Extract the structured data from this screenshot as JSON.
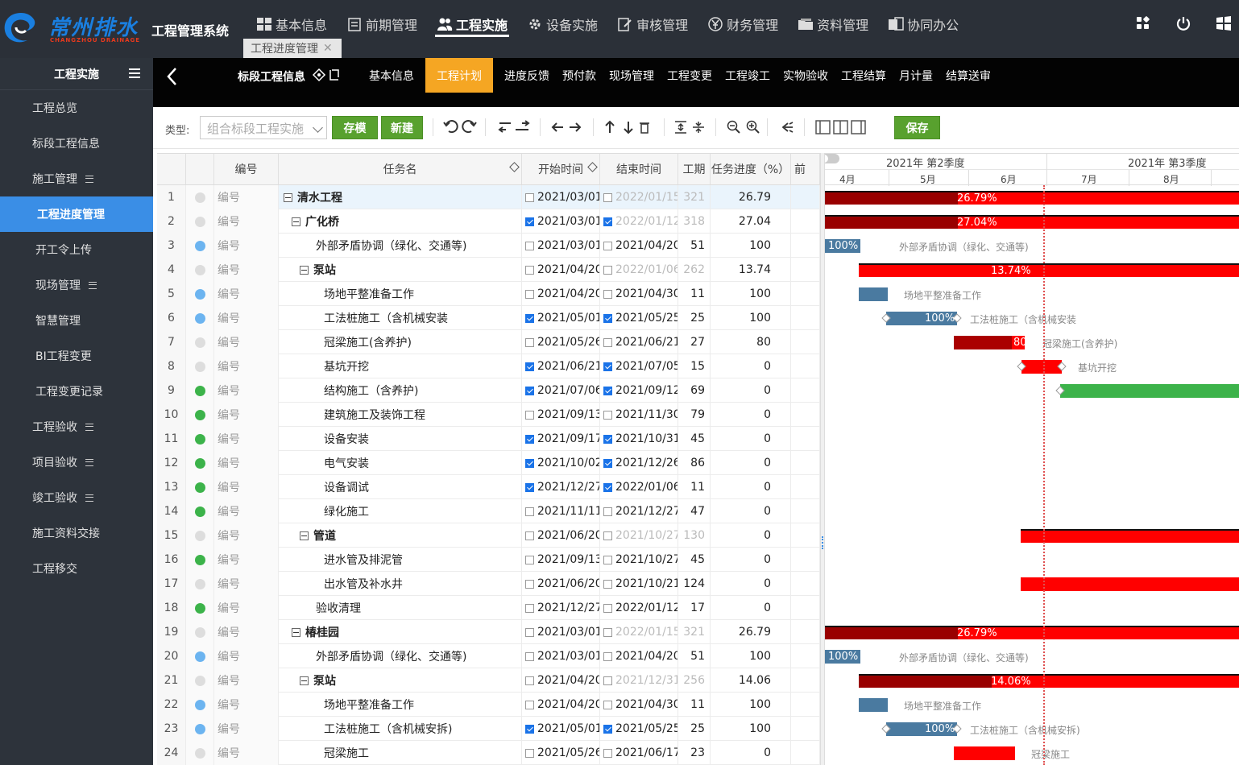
{
  "app": {
    "brand": "常州排水",
    "brand_sub": "CHANGZHOU DRAINAGE",
    "system_name": "工程管理系统"
  },
  "topnav": [
    {
      "label": "基本信息",
      "icon": "grid-icon"
    },
    {
      "label": "前期管理",
      "icon": "clipboard-icon"
    },
    {
      "label": "工程实施",
      "icon": "people-icon",
      "active": true
    },
    {
      "label": "设备实施",
      "icon": "cog-icon"
    },
    {
      "label": "审核管理",
      "icon": "edit-icon"
    },
    {
      "label": "财务管理",
      "icon": "yen-icon"
    },
    {
      "label": "资料管理",
      "icon": "folder-icon"
    },
    {
      "label": "协同办公",
      "icon": "doc-icon"
    }
  ],
  "open_tab": {
    "label": "工程进度管理"
  },
  "sidebar": {
    "title": "工程实施",
    "items": [
      {
        "label": "工程总览"
      },
      {
        "label": "标段工程信息"
      },
      {
        "label": "施工管理"
      },
      {
        "label": "工程进度管理"
      },
      {
        "label": "开工令上传"
      },
      {
        "label": "现场管理"
      },
      {
        "label": "智慧管理"
      },
      {
        "label": "BI工程变更"
      },
      {
        "label": "工程变更记录"
      },
      {
        "label": "工程验收"
      },
      {
        "label": "项目验收"
      },
      {
        "label": "竣工验收"
      },
      {
        "label": "施工资料交接"
      },
      {
        "label": "工程移交"
      }
    ]
  },
  "section": {
    "title": "标段工程信息",
    "tabs": [
      "基本信息",
      "工程计划",
      "进度反馈",
      "预付款",
      "现场管理",
      "工程变更",
      "工程竣工",
      "实物验收",
      "工程结算",
      "月计量",
      "结算送审"
    ],
    "active_tab": "工程计划"
  },
  "toolbar": {
    "type_label": "类型:",
    "type_value": "组合标段工程实施",
    "save_template": "存模",
    "new": "新建",
    "save": "保存"
  },
  "grid": {
    "headers": {
      "code": "编号",
      "name": "任务名",
      "start": "开始时间",
      "end": "结束时间",
      "duration": "工期",
      "progress": "任务进度（%）",
      "pred": "前"
    },
    "rows": [
      {
        "n": "1",
        "dot": "#dddddd",
        "code": "编号",
        "name": "清水工程",
        "level": 0,
        "bold": true,
        "toggle": true,
        "s_chk": false,
        "start": "2021/03/01",
        "e_chk": false,
        "end": "2022/01/15",
        "end_grey": true,
        "dur": "321",
        "progress": "26.79"
      },
      {
        "n": "2",
        "dot": "#dddddd",
        "code": "编号",
        "name": "广化桥",
        "level": 1,
        "bold": true,
        "toggle": true,
        "s_chk": true,
        "start": "2021/03/01",
        "e_chk": true,
        "end": "2022/01/12",
        "end_grey": true,
        "dur": "318",
        "progress": "27.04"
      },
      {
        "n": "3",
        "dot": "#6cb4f0",
        "code": "编号",
        "name": "外部矛盾协调（绿化、交通等)",
        "level": 2,
        "bold": false,
        "toggle": false,
        "s_chk": false,
        "start": "2021/03/01",
        "e_chk": false,
        "end": "2021/04/20",
        "end_grey": false,
        "dur": "51",
        "progress": "100"
      },
      {
        "n": "4",
        "dot": "#dddddd",
        "code": "编号",
        "name": "泵站",
        "level": 2,
        "bold": true,
        "toggle": true,
        "s_chk": false,
        "start": "2021/04/20",
        "e_chk": false,
        "end": "2022/01/06",
        "end_grey": true,
        "dur": "262",
        "progress": "13.74"
      },
      {
        "n": "5",
        "dot": "#6cb4f0",
        "code": "编号",
        "name": "场地平整准备工作",
        "level": 3,
        "bold": false,
        "toggle": false,
        "s_chk": false,
        "start": "2021/04/20",
        "e_chk": false,
        "end": "2021/04/30",
        "end_grey": false,
        "dur": "11",
        "progress": "100"
      },
      {
        "n": "6",
        "dot": "#6cb4f0",
        "code": "编号",
        "name": "工法桩施工（含机械安装",
        "level": 3,
        "bold": false,
        "toggle": false,
        "s_chk": true,
        "start": "2021/05/01",
        "e_chk": true,
        "end": "2021/05/25",
        "end_grey": false,
        "dur": "25",
        "progress": "100"
      },
      {
        "n": "7",
        "dot": "#dddddd",
        "code": "编号",
        "name": "冠梁施工(含养护)",
        "level": 3,
        "bold": false,
        "toggle": false,
        "s_chk": false,
        "start": "2021/05/26",
        "e_chk": false,
        "end": "2021/06/21",
        "end_grey": false,
        "dur": "27",
        "progress": "80"
      },
      {
        "n": "8",
        "dot": "#dddddd",
        "code": "编号",
        "name": "基坑开挖",
        "level": 3,
        "bold": false,
        "toggle": false,
        "s_chk": true,
        "start": "2021/06/21",
        "e_chk": true,
        "end": "2021/07/05",
        "end_grey": false,
        "dur": "15",
        "progress": "0"
      },
      {
        "n": "9",
        "dot": "#3cb34a",
        "code": "编号",
        "name": "结构施工（含养护)",
        "level": 3,
        "bold": false,
        "toggle": false,
        "s_chk": true,
        "start": "2021/07/06",
        "e_chk": true,
        "end": "2021/09/12",
        "end_grey": false,
        "dur": "69",
        "progress": "0"
      },
      {
        "n": "10",
        "dot": "#3cb34a",
        "code": "编号",
        "name": "建筑施工及装饰工程",
        "level": 3,
        "bold": false,
        "toggle": false,
        "s_chk": false,
        "start": "2021/09/13",
        "e_chk": false,
        "end": "2021/11/30",
        "end_grey": false,
        "dur": "79",
        "progress": "0"
      },
      {
        "n": "11",
        "dot": "#3cb34a",
        "code": "编号",
        "name": "设备安装",
        "level": 3,
        "bold": false,
        "toggle": false,
        "s_chk": true,
        "start": "2021/09/17",
        "e_chk": true,
        "end": "2021/10/31",
        "end_grey": false,
        "dur": "45",
        "progress": "0"
      },
      {
        "n": "12",
        "dot": "#3cb34a",
        "code": "编号",
        "name": "电气安装",
        "level": 3,
        "bold": false,
        "toggle": false,
        "s_chk": true,
        "start": "2021/10/02",
        "e_chk": true,
        "end": "2021/12/26",
        "end_grey": false,
        "dur": "86",
        "progress": "0"
      },
      {
        "n": "13",
        "dot": "#3cb34a",
        "code": "编号",
        "name": "设备调试",
        "level": 3,
        "bold": false,
        "toggle": false,
        "s_chk": true,
        "start": "2021/12/27",
        "e_chk": true,
        "end": "2022/01/06",
        "end_grey": false,
        "dur": "11",
        "progress": "0"
      },
      {
        "n": "14",
        "dot": "#3cb34a",
        "code": "编号",
        "name": "绿化施工",
        "level": 3,
        "bold": false,
        "toggle": false,
        "s_chk": false,
        "start": "2021/11/11",
        "e_chk": false,
        "end": "2021/12/27",
        "end_grey": false,
        "dur": "47",
        "progress": "0"
      },
      {
        "n": "15",
        "dot": "#dddddd",
        "code": "编号",
        "name": "管道",
        "level": 2,
        "bold": true,
        "toggle": true,
        "s_chk": false,
        "start": "2021/06/20",
        "e_chk": false,
        "end": "2021/10/27",
        "end_grey": true,
        "dur": "130",
        "progress": "0"
      },
      {
        "n": "16",
        "dot": "#3cb34a",
        "code": "编号",
        "name": "进水管及排泥管",
        "level": 3,
        "bold": false,
        "toggle": false,
        "s_chk": false,
        "start": "2021/09/13",
        "e_chk": false,
        "end": "2021/10/27",
        "end_grey": false,
        "dur": "45",
        "progress": "0"
      },
      {
        "n": "17",
        "dot": "#dddddd",
        "code": "编号",
        "name": "出水管及补水井",
        "level": 3,
        "bold": false,
        "toggle": false,
        "s_chk": false,
        "start": "2021/06/20",
        "e_chk": false,
        "end": "2021/10/21",
        "end_grey": false,
        "dur": "124",
        "progress": "0"
      },
      {
        "n": "18",
        "dot": "#3cb34a",
        "code": "编号",
        "name": "验收清理",
        "level": 2,
        "bold": false,
        "toggle": false,
        "s_chk": false,
        "start": "2021/12/27",
        "e_chk": false,
        "end": "2022/01/12",
        "end_grey": false,
        "dur": "17",
        "progress": "0"
      },
      {
        "n": "19",
        "dot": "#dddddd",
        "code": "编号",
        "name": "椿桂园",
        "level": 1,
        "bold": true,
        "toggle": true,
        "s_chk": false,
        "start": "2021/03/01",
        "e_chk": false,
        "end": "2022/01/15",
        "end_grey": true,
        "dur": "321",
        "progress": "26.79"
      },
      {
        "n": "20",
        "dot": "#6cb4f0",
        "code": "编号",
        "name": "外部矛盾协调（绿化、交通等)",
        "level": 2,
        "bold": false,
        "toggle": false,
        "s_chk": false,
        "start": "2021/03/01",
        "e_chk": false,
        "end": "2021/04/20",
        "end_grey": false,
        "dur": "51",
        "progress": "100"
      },
      {
        "n": "21",
        "dot": "#dddddd",
        "code": "编号",
        "name": "泵站",
        "level": 2,
        "bold": true,
        "toggle": true,
        "s_chk": false,
        "start": "2021/04/20",
        "e_chk": false,
        "end": "2021/12/31",
        "end_grey": true,
        "dur": "256",
        "progress": "14.06"
      },
      {
        "n": "22",
        "dot": "#6cb4f0",
        "code": "编号",
        "name": "场地平整准备工作",
        "level": 3,
        "bold": false,
        "toggle": false,
        "s_chk": false,
        "start": "2021/04/20",
        "e_chk": false,
        "end": "2021/04/30",
        "end_grey": false,
        "dur": "11",
        "progress": "100"
      },
      {
        "n": "23",
        "dot": "#6cb4f0",
        "code": "编号",
        "name": "工法桩施工（含机械安拆)",
        "level": 3,
        "bold": false,
        "toggle": false,
        "s_chk": true,
        "start": "2021/05/01",
        "e_chk": true,
        "end": "2021/05/25",
        "end_grey": false,
        "dur": "25",
        "progress": "100"
      },
      {
        "n": "24",
        "dot": "#dddddd",
        "code": "编号",
        "name": "冠梁施工",
        "level": 3,
        "bold": false,
        "toggle": false,
        "s_chk": false,
        "start": "2021/05/26",
        "e_chk": false,
        "end": "2021/06/17",
        "end_grey": false,
        "dur": "23",
        "progress": "0"
      }
    ]
  },
  "gantt": {
    "quarters": [
      "2021年 第2季度",
      "2021年 第3季度"
    ],
    "months": [
      "4月",
      "5月",
      "6月",
      "7月",
      "8月"
    ],
    "bars": [
      {
        "row": 0,
        "text": "26.79%",
        "label": "",
        "color": "#ff0000",
        "done": "#990000",
        "summary": true
      },
      {
        "row": 1,
        "text": "27.04%",
        "label": "",
        "color": "#ff0000",
        "done": "#990000",
        "summary": true
      },
      {
        "row": 2,
        "text": "100%",
        "label": "外部矛盾协调（绿化、交通等)",
        "color": "#4a7aa0"
      },
      {
        "row": 3,
        "text": "13.74%",
        "label": "",
        "color": "#ff0000",
        "done": "#990000",
        "summary": true
      },
      {
        "row": 4,
        "text": "",
        "label": "场地平整准备工作",
        "color": "#4a7aa0"
      },
      {
        "row": 5,
        "text": "100%",
        "label": "工法桩施工（含机械安装",
        "color": "#4a7aa0",
        "diamonds": true
      },
      {
        "row": 6,
        "text": "80",
        "label": "冠梁施工(含养护)",
        "color": "#ff0000",
        "done": "#aa0000"
      },
      {
        "row": 7,
        "text": "",
        "label": "基坑开挖",
        "color": "#ff0000",
        "diamonds": true
      },
      {
        "row": 8,
        "text": "",
        "label": "",
        "color": "#3cb34a",
        "diamonds": true
      },
      {
        "row": 14,
        "text": "",
        "label": "",
        "color": "#ff0000",
        "summary": true
      },
      {
        "row": 16,
        "text": "",
        "label": "",
        "color": "#ff0000"
      },
      {
        "row": 18,
        "text": "26.79%",
        "label": "",
        "color": "#ff0000",
        "done": "#990000",
        "summary": true
      },
      {
        "row": 19,
        "text": "100%",
        "label": "外部矛盾协调（绿化、交通等)",
        "color": "#4a7aa0"
      },
      {
        "row": 20,
        "text": "14.06%",
        "label": "",
        "color": "#ff0000",
        "done": "#990000",
        "summary": true
      },
      {
        "row": 21,
        "text": "",
        "label": "场地平整准备工作",
        "color": "#4a7aa0"
      },
      {
        "row": 22,
        "text": "100%",
        "label": "工法桩施工（含机械安拆)",
        "color": "#4a7aa0",
        "diamonds": true
      },
      {
        "row": 23,
        "text": "",
        "label": "冠梁施工",
        "color": "#ff0000"
      }
    ]
  }
}
